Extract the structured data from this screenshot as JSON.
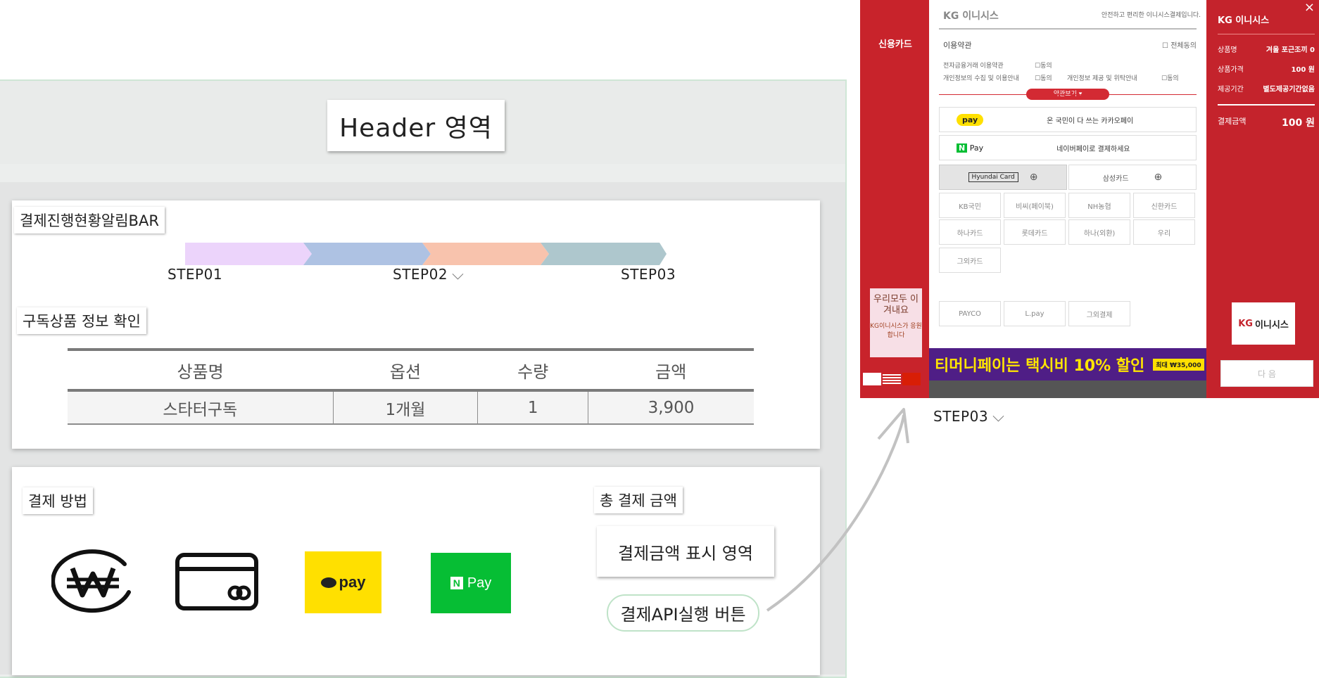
{
  "header": {
    "label": "Header 영역"
  },
  "progress": {
    "section_label": "결제진행현황알림BAR",
    "steps": [
      "STEP01",
      "STEP02",
      "STEP03"
    ],
    "colors": [
      "#ecd4fb",
      "#aec2e3",
      "#f8c3ad",
      "#aec7cd"
    ]
  },
  "product": {
    "section_label": "구독상품 정보 확인",
    "columns": [
      "상품명",
      "옵션",
      "수량",
      "금액"
    ],
    "rows": [
      [
        "스타터구독",
        "1개월",
        "1",
        "3,900"
      ]
    ]
  },
  "payment": {
    "section_label": "결제 방법",
    "methods": [
      "won-icon",
      "card-icon",
      "kakaopay",
      "naverpay"
    ],
    "kakao_text": "pay",
    "npay_logo": "N",
    "npay_text": "Pay"
  },
  "total": {
    "section_label": "총 결제 금액",
    "amount_area": "결제금액 표시 영역",
    "api_button": "결제API실행 버튼"
  },
  "popup": {
    "left_tab": "신용카드",
    "brand": "KG 이니시스",
    "tagline": "안전하고 편리한 이니시스결제입니다.",
    "terms_title": "이용약관",
    "agree_all": "전체동의",
    "term1": "전자금융거래 이용약관",
    "term2": "개인정보의 수집 및 이용안내",
    "term3": "개인정보 제공 및 위탁안내",
    "agree": "동의",
    "view_terms": "약관보기 ▾",
    "kakao_badge": "pay",
    "kakao_desc": "온 국민이 다 쓰는 카카오페이",
    "naver_badge": "Pay",
    "naver_desc": "네이버페이로 결제하세요",
    "hyundai": "Hyundai Card",
    "samsung": "삼성카드",
    "cards": [
      "KB국민",
      "비씨(페이북)",
      "NH농협",
      "신한카드",
      "하나카드",
      "롯데카드",
      "하나(외환)",
      "우리",
      "그외카드"
    ],
    "extra": [
      "PAYCO",
      "L.pay",
      "그외결제"
    ],
    "banner": "티머니페이는 택시비 10% 할인",
    "banner_max": "최대 ₩35,000",
    "ad_text": "우리모두 이겨내요",
    "ad_sub": "KG이니시스가 응원합니다",
    "right_brand": "KG 이니시스",
    "right_rows": [
      {
        "k": "상품명",
        "v": "겨울 포근조끼 0"
      },
      {
        "k": "상품가격",
        "v": "100 원"
      },
      {
        "k": "제공기간",
        "v": "별도제공기간없음"
      }
    ],
    "total_label": "결제금액",
    "total_value": "100 원",
    "logo_text": "이니시스",
    "next": "다 음",
    "close": "×"
  },
  "step03_label": "STEP03"
}
